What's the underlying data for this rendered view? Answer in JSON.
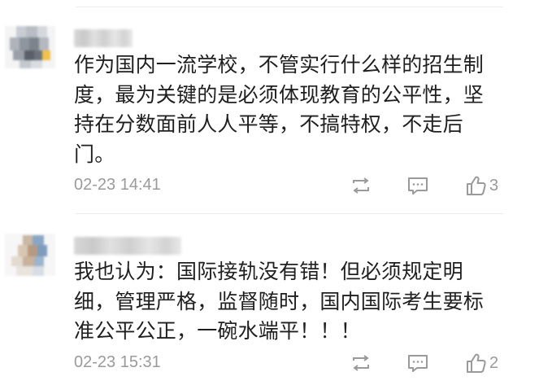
{
  "comments": [
    {
      "username": "",
      "text": "作为国内一流学校，不管实行什么样的招生制\n度，最为关键的是必须体现教育的公平性，坚\n持在分数面前人人平等，不搞特权，不走后\n门。",
      "time": "02-23 14:41",
      "like_count": "3",
      "icons": [
        "repost-icon",
        "comment-icon",
        "like-icon"
      ]
    },
    {
      "username": "",
      "text": "我也认为：国际接轨没有错！但必须规定明\n细，管理严格，监督随时，国内国际考生要标\n准公平公正，一碗水端平！！！",
      "time": "02-23 15:31",
      "like_count": "2",
      "icons": [
        "repost-icon",
        "comment-icon",
        "like-icon"
      ]
    }
  ],
  "colors": {
    "text": "#1f1f1f",
    "meta": "#9a9a9a",
    "divider": "#ececec"
  }
}
